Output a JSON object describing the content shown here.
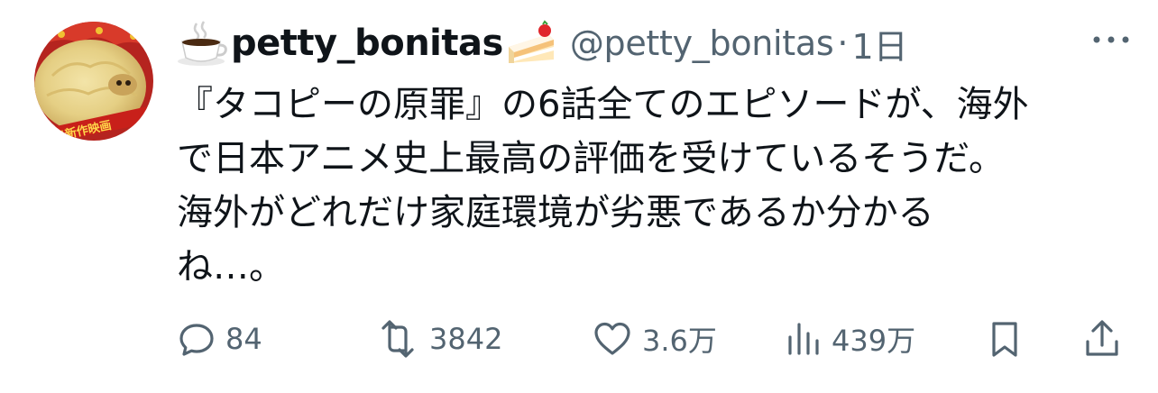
{
  "post": {
    "display_name": "petty_bonitas",
    "name_prefix_emoji": "coffee-cup-icon",
    "name_suffix_emoji": "shortcake-icon",
    "handle": "@petty_bonitas",
    "separator": "·",
    "time": "1日",
    "avatar_banner_text": "祝!新作映画",
    "text_lines": [
      "『タコピーの原罪』の6話全てのエピソードが、海外",
      "で日本アニメ史上最高の評価を受けているそうだ。",
      "海外がどれだけ家庭環境が劣悪であるか分かる",
      "ね…。"
    ]
  },
  "actions": {
    "reply": {
      "icon": "reply-icon",
      "count": "84"
    },
    "repost": {
      "icon": "repost-icon",
      "count": "3842"
    },
    "like": {
      "icon": "heart-icon",
      "count": "3.6万"
    },
    "views": {
      "icon": "views-bar-chart-icon",
      "count": "439万"
    },
    "bookmark": {
      "icon": "bookmark-icon"
    },
    "share": {
      "icon": "share-icon"
    }
  },
  "colors": {
    "text": "#0f1419",
    "muted": "#536471",
    "background": "#ffffff"
  }
}
